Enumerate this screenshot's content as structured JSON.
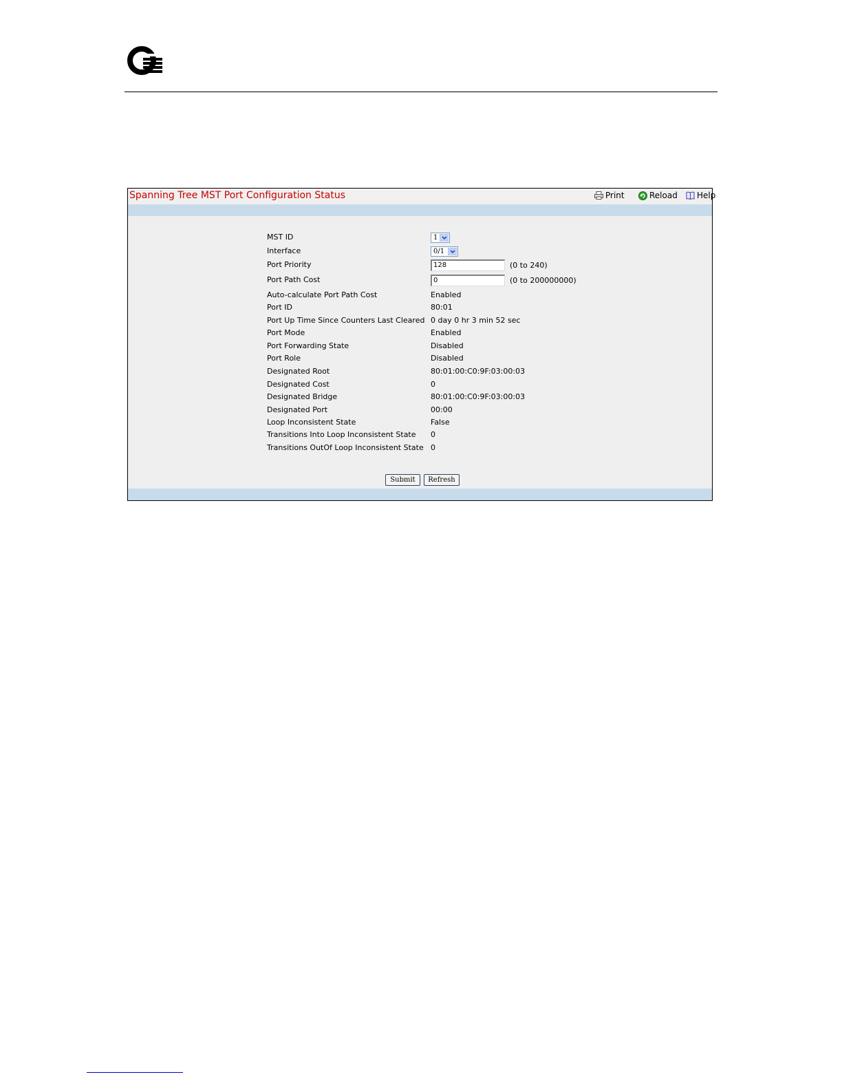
{
  "panel": {
    "title": "Spanning Tree MST Port Configuration Status",
    "toolbar": {
      "print": "Print",
      "reload": "Reload",
      "help": "Help"
    }
  },
  "fields": [
    {
      "label": "MST ID"
    },
    {
      "label": "Interface"
    },
    {
      "label": "Port Priority"
    },
    {
      "label": "Port Path Cost"
    },
    {
      "label": "Auto-calculate Port Path Cost",
      "value": "Enabled"
    },
    {
      "label": "Port ID",
      "value": "80:01"
    },
    {
      "label": "Port Up Time Since Counters Last Cleared",
      "value": "0 day 0 hr 3 min 52 sec"
    },
    {
      "label": "Port Mode",
      "value": "Enabled"
    },
    {
      "label": "Port Forwarding State",
      "value": "Disabled"
    },
    {
      "label": "Port Role",
      "value": "Disabled"
    },
    {
      "label": "Designated Root",
      "value": "80:01:00:C0:9F:03:00:03"
    },
    {
      "label": "Designated Cost",
      "value": "0"
    },
    {
      "label": "Designated Bridge",
      "value": "80:01:00:C0:9F:03:00:03"
    },
    {
      "label": "Designated Port",
      "value": "00:00"
    },
    {
      "label": "Loop Inconsistent State",
      "value": "False"
    },
    {
      "label": "Transitions Into Loop Inconsistent State",
      "value": "0"
    },
    {
      "label": "Transitions OutOf Loop Inconsistent State",
      "value": "0"
    }
  ],
  "controls": {
    "mst_id_selected": "1",
    "interface_selected": "0/1",
    "port_priority_value": "128",
    "port_priority_range": "(0 to 240)",
    "port_path_cost_value": "0",
    "port_path_cost_range": "(0 to 200000000)"
  },
  "buttons": {
    "submit": "Submit",
    "refresh": "Refresh"
  },
  "colors": {
    "title": "#cc0000",
    "band": "#c7dbea",
    "panel_bg": "#efefef"
  }
}
